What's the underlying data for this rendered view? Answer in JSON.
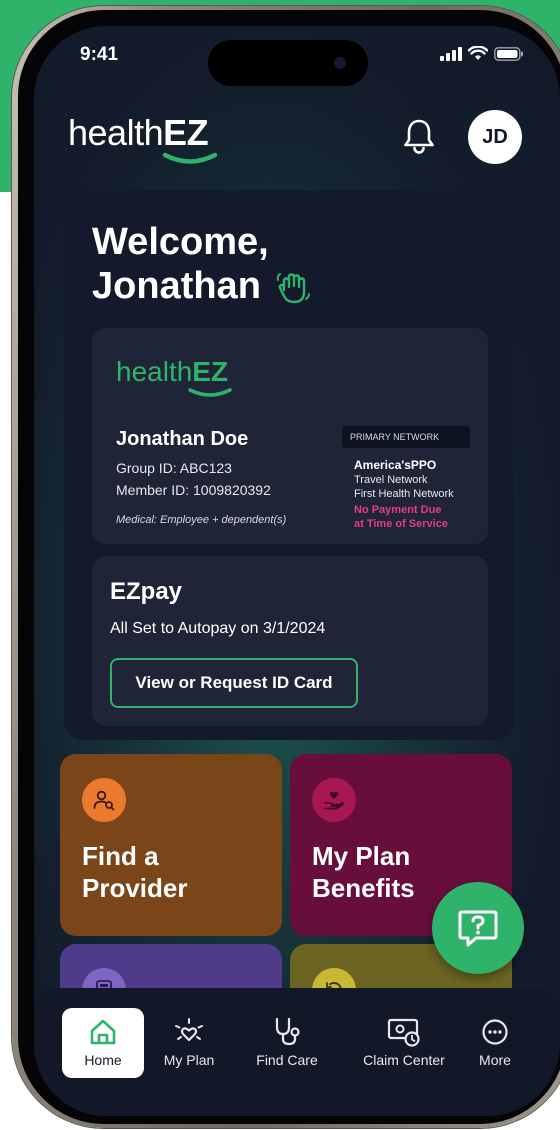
{
  "status_bar": {
    "time": "9:41"
  },
  "header": {
    "logo_light": "health",
    "logo_bold": "EZ",
    "avatar_initials": "JD"
  },
  "welcome": {
    "line1": "Welcome,",
    "line2": "Jonathan"
  },
  "id_card": {
    "logo_light": "health",
    "logo_bold": "EZ",
    "member_name": "Jonathan Doe",
    "group_id": "Group ID: ABC123",
    "member_id": "Member ID: 1009820392",
    "coverage": "Medical: Employee + dependent(s)",
    "network_badge": "PRIMARY NETWORK",
    "network_main_a": "America's",
    "network_main_b": "PPO",
    "network_line1": "Travel Network",
    "network_line2": "First Health Network",
    "notice_line1": "No Payment Due",
    "notice_line2": "at Time of Service"
  },
  "ezpay": {
    "title": "EZpay",
    "status": "All Set to Autopay on 3/1/2024",
    "button_label": "View or Request ID Card"
  },
  "tiles": [
    {
      "line1": "Find a",
      "line2": "Provider"
    },
    {
      "line1": "My Plan",
      "line2": "Benefits"
    }
  ],
  "bottom_nav": [
    {
      "label": "Home"
    },
    {
      "label": "My Plan"
    },
    {
      "label": "Find Care"
    },
    {
      "label": "Claim Center"
    },
    {
      "label": "More"
    }
  ],
  "colors": {
    "brand_green": "#2fb36a",
    "tile_provider": "#7a4519",
    "tile_benefits": "#680e3b",
    "tile_provider_icon": "#ec7a2e",
    "tile_benefits_icon": "#a8174f",
    "notice_pink": "#e53a8f"
  },
  "icons": {
    "bell": "bell-icon",
    "wave": "waving-hand-icon",
    "provider": "person-search-icon",
    "benefits": "hand-heart-icon",
    "chat": "chat-help-icon",
    "home": "home-icon",
    "my_plan": "heart-sparkle-icon",
    "find_care": "stethoscope-icon",
    "claim_center": "claim-money-clock-icon",
    "more": "more-dots-icon"
  }
}
